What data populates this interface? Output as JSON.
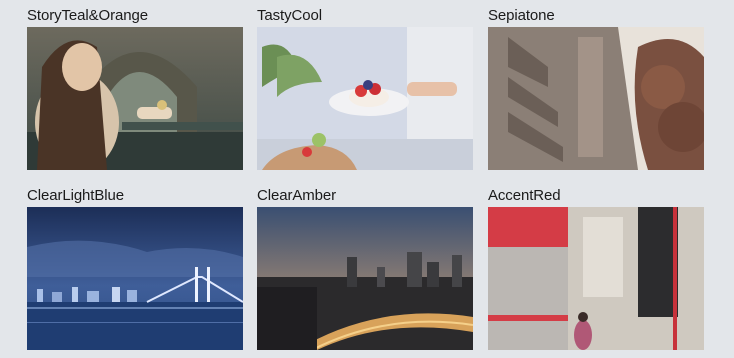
{
  "filters": [
    {
      "label": "StoryTeal&Orange",
      "icon": "woman-at-canal-photo"
    },
    {
      "label": "TastyCool",
      "icon": "dessert-plate-photo"
    },
    {
      "label": "Sepiatone",
      "icon": "building-and-tree-photo"
    },
    {
      "label": "ClearLightBlue",
      "icon": "bridge-night-skyline-photo"
    },
    {
      "label": "ClearAmber",
      "icon": "city-dusk-highway-photo"
    },
    {
      "label": "AccentRed",
      "icon": "red-awning-street-photo"
    }
  ],
  "colors": {
    "background": "#e3e6ea",
    "label_text": "#1b1b1b"
  }
}
